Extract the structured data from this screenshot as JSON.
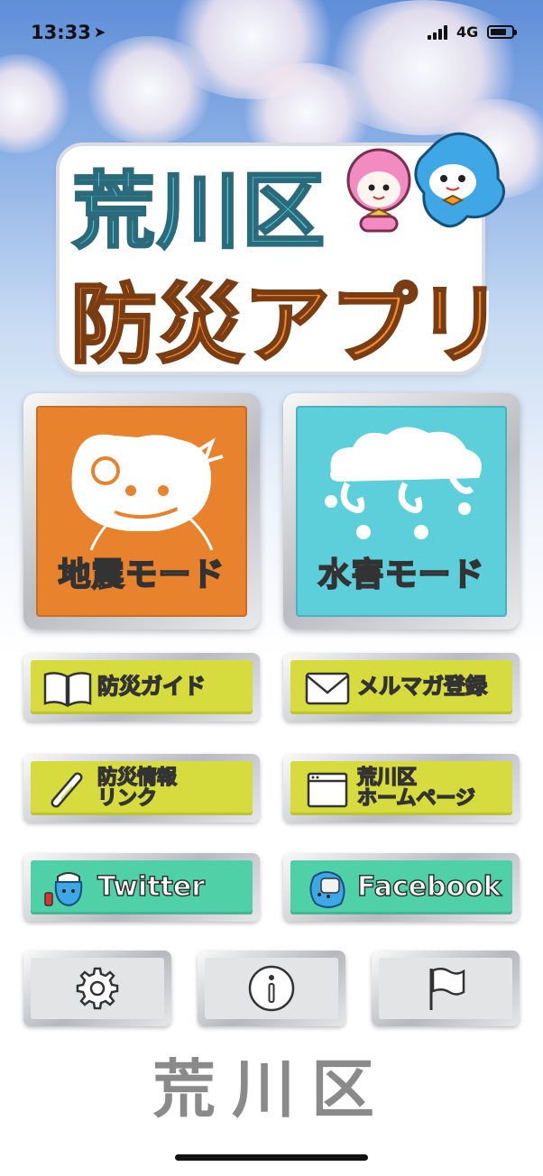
{
  "status": {
    "time": "13:33",
    "network": "4G",
    "battery_level": 0.75
  },
  "logo": {
    "line1": "荒川区",
    "line2": "防災アプリ"
  },
  "modes": [
    {
      "label": "地震モード",
      "color": "#e8822c"
    },
    {
      "label": "水害モード",
      "color": "#5ccfdb"
    }
  ],
  "menu": {
    "guide": {
      "label": "防災ガイド",
      "icon": "book-icon"
    },
    "mailmag": {
      "label": "メルマガ登録",
      "icon": "mail-icon"
    },
    "links": {
      "line1": "防災情報",
      "line2": "リンク",
      "icon": "link-icon"
    },
    "homepage": {
      "line1": "荒川区",
      "line2": "ホームページ",
      "icon": "browser-icon"
    },
    "twitter": {
      "label": "Twitter",
      "icon": "twitter-mascot-icon"
    },
    "facebook": {
      "label": "Facebook",
      "icon": "facebook-mascot-icon"
    }
  },
  "utility": [
    {
      "icon": "gear-icon"
    },
    {
      "icon": "info-icon"
    },
    {
      "icon": "flag-icon"
    }
  ],
  "footer": {
    "logo": "荒川区"
  },
  "colors": {
    "yellow_button": "#d6dc3e",
    "green_button": "#4fd0a6",
    "logo_blue": "#55c8d7",
    "logo_orange": "#ef8a2f"
  }
}
